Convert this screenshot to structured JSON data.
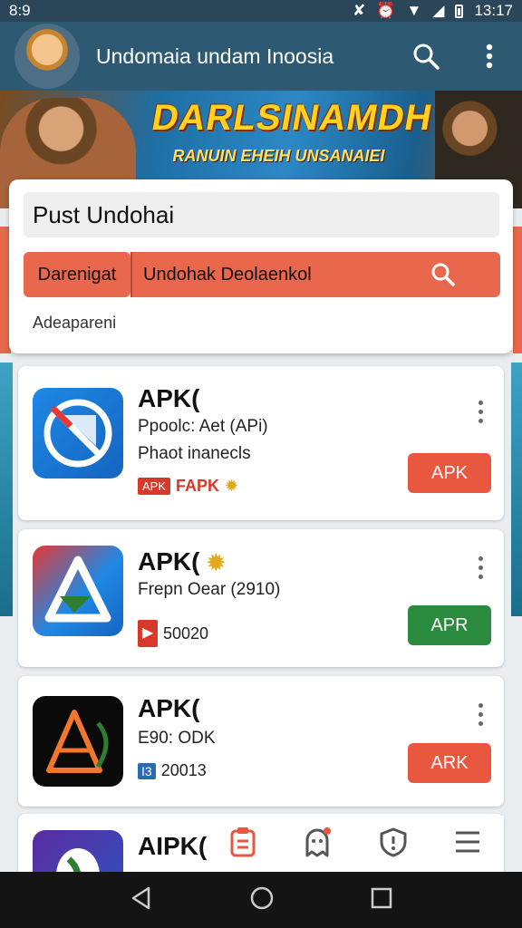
{
  "status_bar": {
    "time": "8:9",
    "clock": "13:17"
  },
  "app_bar": {
    "title": "Undomaia undam Inoosia"
  },
  "banner": {
    "headline": "DARLSINAMDH",
    "subline": "RANUIN EHEIH UNSANAIEI"
  },
  "search": {
    "field_value": "Pust Undohai",
    "filter_label": "Darenigat",
    "action_label": "Undohak Deolaenkol",
    "hint": "Adeapareni"
  },
  "apps": [
    {
      "name": "APK(",
      "line1": "Ppoolc: Aet  (APi)",
      "line2": "Phaot inanecls",
      "badge": "APK",
      "badge_text": "FAPK",
      "button": "APK",
      "button_color": "#e9573f"
    },
    {
      "name": "APK(",
      "line1": "Frepn Oear  (2910)",
      "meta": "50020",
      "button": "APR",
      "button_color": "#2a8a3e"
    },
    {
      "name": "APK(",
      "line1": "E90: ODK",
      "badge": "I3",
      "meta": "20013",
      "button": "ARK",
      "button_color": "#e9573f"
    },
    {
      "name": "AIPK("
    }
  ],
  "icons": [
    "search-icon",
    "more-vert-icon",
    "clipboard-icon",
    "ghost-icon",
    "shield-icon",
    "menu-icon",
    "back-icon",
    "home-icon",
    "recents-icon"
  ]
}
